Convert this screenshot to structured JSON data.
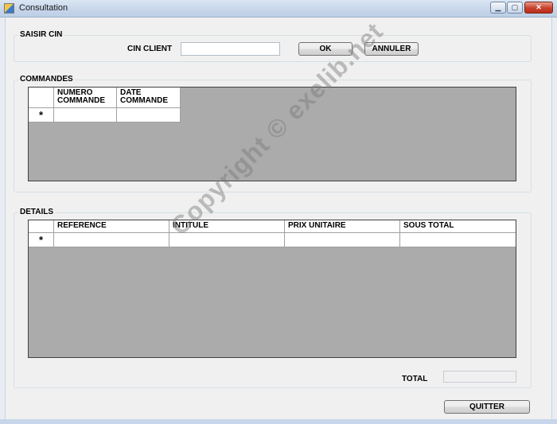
{
  "window": {
    "title": "Consultation",
    "controls": {
      "minimize": "▁",
      "maximize": "▢",
      "close": "✕"
    }
  },
  "saisir": {
    "group_label": "SAISIR CIN",
    "cin_label": "CIN CLIENT",
    "cin_value": "",
    "ok_label": "OK",
    "annuler_label": "ANNULER"
  },
  "commandes": {
    "group_label": "COMMANDES",
    "columns": [
      "NUMERO\nCOMMANDE",
      "DATE\nCOMMANDE"
    ],
    "new_row_marker": "*"
  },
  "details": {
    "group_label": "DETAILS",
    "columns": [
      "REFERENCE",
      "INTITULE",
      "PRIX UNITAIRE",
      "SOUS TOTAL"
    ],
    "new_row_marker": "*",
    "total_label": "TOTAL",
    "total_value": ""
  },
  "quitter_label": "QUITTER",
  "watermark": "Copyright © exelib.net",
  "colors": {
    "grid_background": "#ababab",
    "form_background": "#f0f0f0"
  }
}
